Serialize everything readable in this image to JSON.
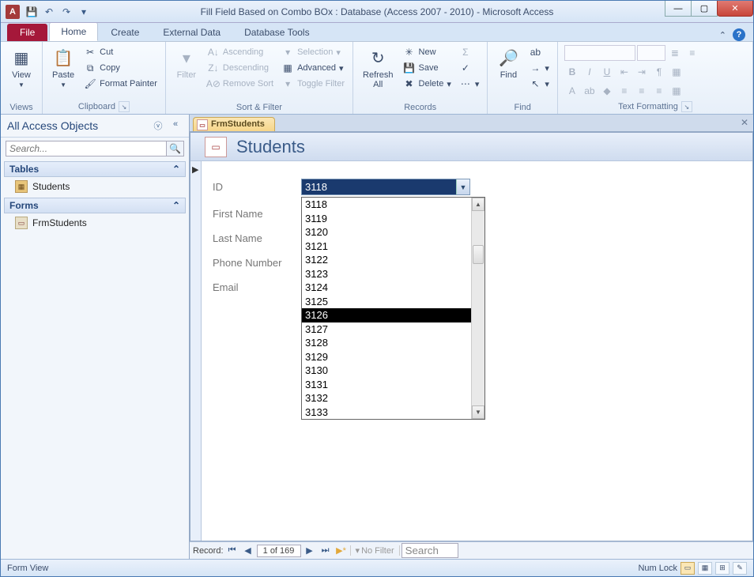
{
  "titlebar": {
    "title": "Fill Field Based on Combo BOx : Database (Access 2007 - 2010)  -  Microsoft Access",
    "app_letter": "A"
  },
  "tabs": {
    "file": "File",
    "home": "Home",
    "create": "Create",
    "external": "External Data",
    "dbtools": "Database Tools"
  },
  "ribbon": {
    "views": {
      "view": "View",
      "group": "Views"
    },
    "clipboard": {
      "paste": "Paste",
      "cut": "Cut",
      "copy": "Copy",
      "fmt": "Format Painter",
      "group": "Clipboard"
    },
    "sortfilter": {
      "filter": "Filter",
      "asc": "Ascending",
      "desc": "Descending",
      "remove": "Remove Sort",
      "sel": "Selection",
      "adv": "Advanced",
      "toggle": "Toggle Filter",
      "group": "Sort & Filter"
    },
    "records": {
      "refresh": "Refresh\nAll",
      "new": "New",
      "save": "Save",
      "delete": "Delete",
      "totals": "Σ",
      "spell": "✓",
      "more": "⋯",
      "group": "Records"
    },
    "find": {
      "find": "Find",
      "group": "Find"
    },
    "textfmt": {
      "group": "Text Formatting"
    }
  },
  "nav": {
    "header": "All Access Objects",
    "search_ph": "Search...",
    "cat_tables": "Tables",
    "item_students": "Students",
    "cat_forms": "Forms",
    "item_frm": "FrmStudents"
  },
  "doc": {
    "tab": "FrmStudents",
    "title": "Students"
  },
  "fields": {
    "id": "ID",
    "first": "First Name",
    "last": "Last Name",
    "phone": "Phone Number",
    "email": "Email",
    "id_value": "3118"
  },
  "dropdown": {
    "items": [
      "3118",
      "3119",
      "3120",
      "3121",
      "3122",
      "3123",
      "3124",
      "3125",
      "3126",
      "3127",
      "3128",
      "3129",
      "3130",
      "3131",
      "3132",
      "3133"
    ],
    "highlighted": "3126"
  },
  "recnav": {
    "label": "Record:",
    "pos": "1 of 169",
    "nofilter": "No Filter",
    "search": "Search"
  },
  "status": {
    "left": "Form View",
    "numlock": "Num Lock"
  }
}
